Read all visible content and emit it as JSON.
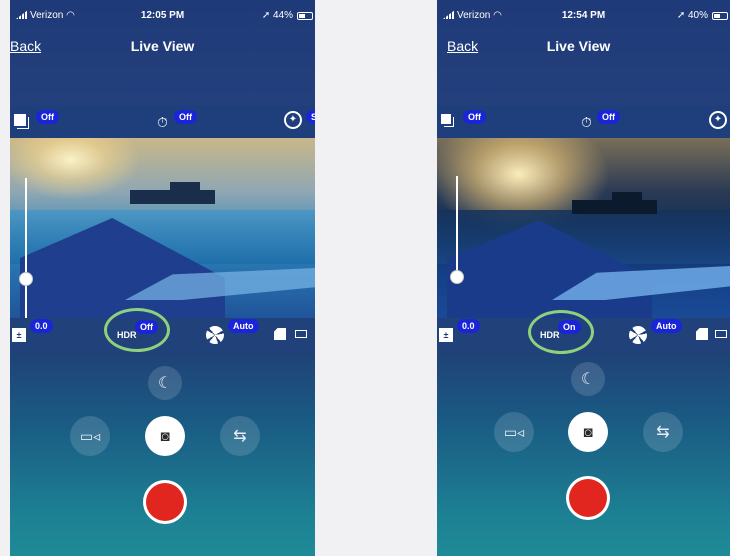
{
  "screens": [
    {
      "status": {
        "carrier": "Verizon",
        "time": "12:05 PM",
        "battery": "44%"
      },
      "nav": {
        "back_label": "Back",
        "title": "Live View"
      },
      "top_controls": {
        "drive_mode_value": "Off",
        "timer_value": "Off"
      },
      "bottom_controls": {
        "ev_value": "0.0",
        "hdr_label": "HDR",
        "hdr_value": "Off",
        "aperture_value": "Auto"
      }
    },
    {
      "status": {
        "carrier": "Verizon",
        "time": "12:54 PM",
        "battery": "40%"
      },
      "nav": {
        "back_label": "Back",
        "title": "Live View"
      },
      "top_controls": {
        "drive_mode_value": "Off",
        "timer_value": "Off"
      },
      "bottom_controls": {
        "ev_value": "0.0",
        "hdr_label": "HDR",
        "hdr_value": "On",
        "aperture_value": "Auto"
      }
    }
  ],
  "icons": {
    "drive_mode": "drive-mode-icon",
    "timer": "timer-icon",
    "focus": "focus-icon",
    "ev": "exposure-compensation-icon",
    "aperture": "aperture-icon",
    "card": "sd-card-icon",
    "battery": "battery-icon",
    "night": "moon-icon",
    "video": "video-camera-icon",
    "photo": "camera-icon",
    "switch": "switch-camera-icon",
    "shutter": "record-shutter-icon"
  },
  "colors": {
    "pill_blue": "#1a25d8",
    "highlight_green": "#8fd07b",
    "shutter_red": "#e0261e"
  }
}
